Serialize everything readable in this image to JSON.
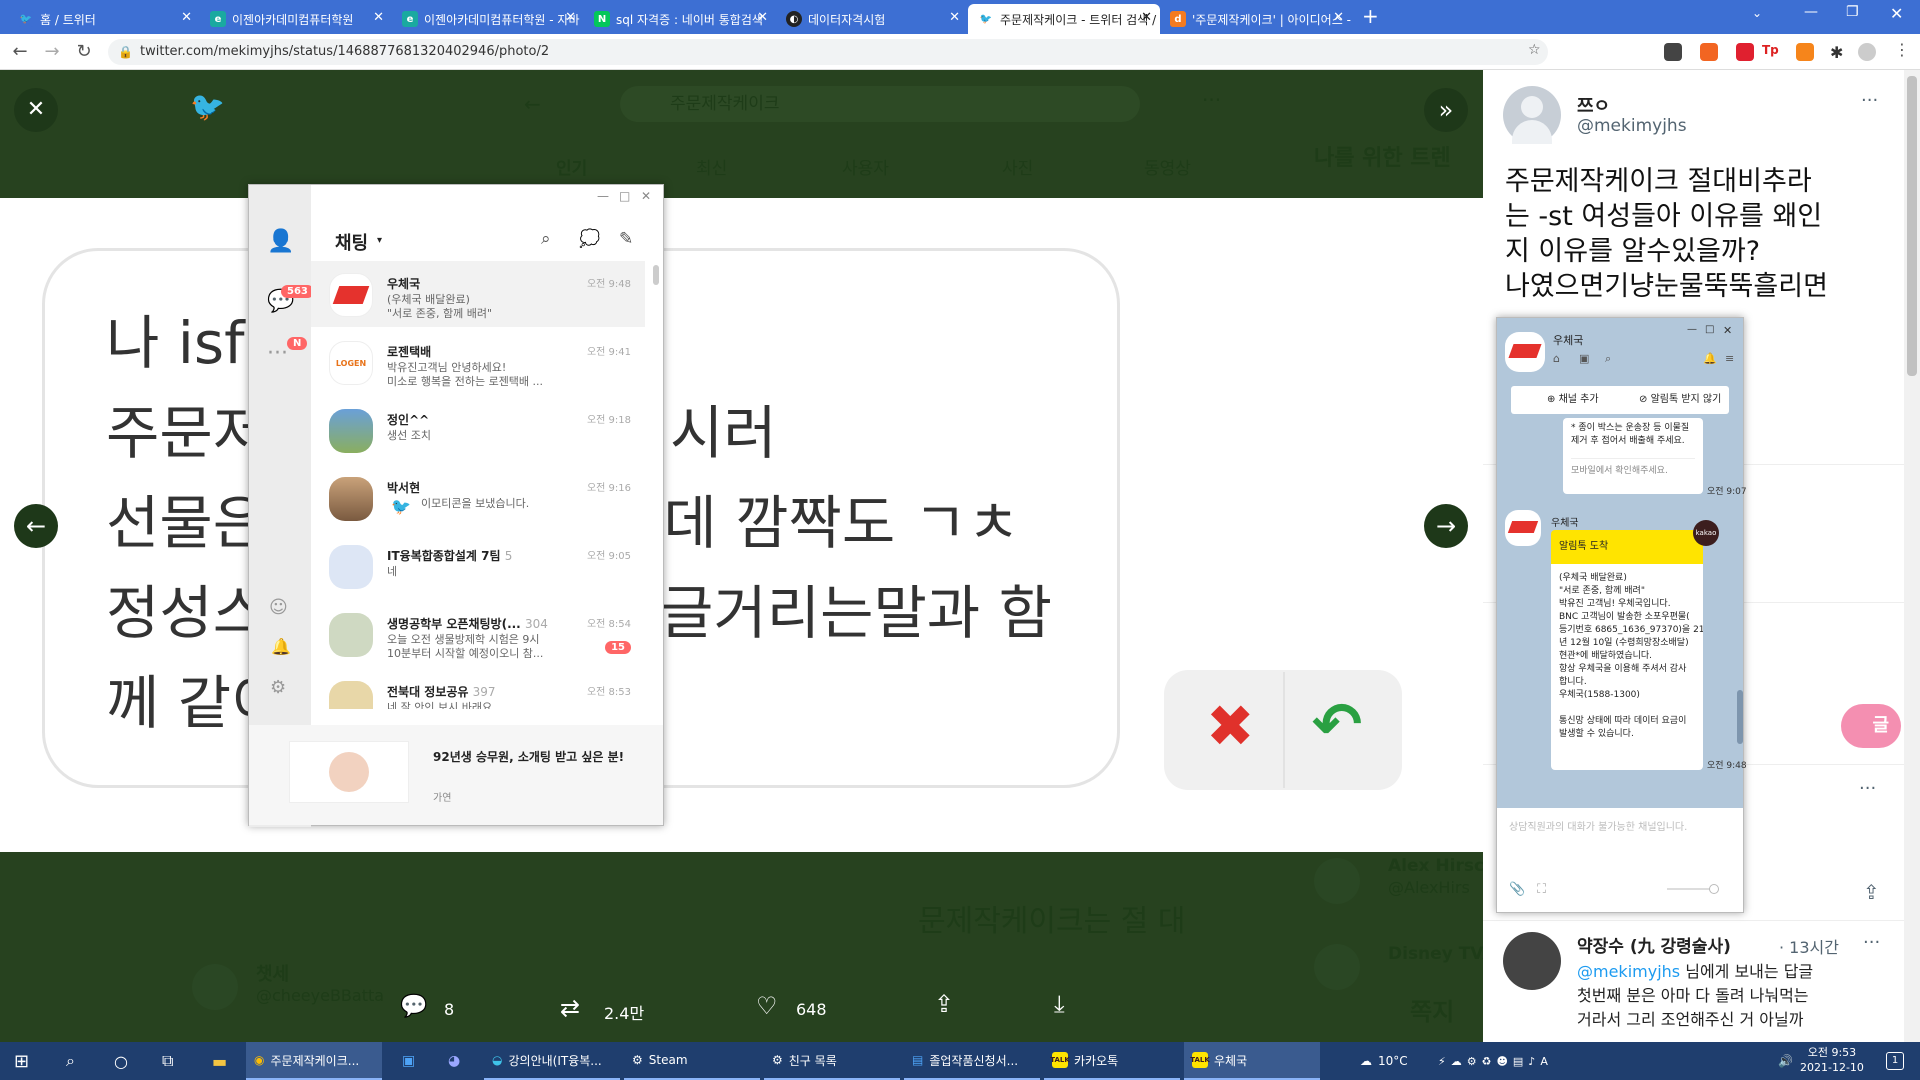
{
  "tabs": [
    {
      "title": "홈 / 트위터",
      "color": "#1d9bf0"
    },
    {
      "title": "이젠아카데미컴퓨터학원",
      "color": "#1aa9a0"
    },
    {
      "title": "이젠아카데미컴퓨터학원 - 자바",
      "color": "#1aa9a0"
    },
    {
      "title": "sql 자격증 : 네이버 통합검색",
      "color": "#03c75a"
    },
    {
      "title": "데이터자격시험",
      "color": "#222222"
    },
    {
      "title": "주문제작케이크 - 트위터 검색 / ",
      "color": "#1d9bf0"
    },
    {
      "title": "'주문제작케이크' | 아이디어스 - ",
      "color": "#f47b20"
    }
  ],
  "address": {
    "url": "twitter.com/mekimyjhs/status/1468877681320402946/photo/2"
  },
  "viewer": {
    "bg_search": "주문제작케이크",
    "bg_tabs": [
      "인기",
      "최신",
      "사용자",
      "사진",
      "동영상"
    ],
    "bg_trends": "나를 위한 트렌",
    "bg_text": "문제작케이크는 절 대",
    "bg_user1": "챗세",
    "bg_handle1": "@cheeyeBBatta",
    "bg_user2": "Alex Hirsch",
    "bg_handle2": "@AlexHirs",
    "bg_user3": "Disney TVA",
    "bg_bottom": "쪽지",
    "lines": [
      "나 isf",
      "주문저",
      "선물은",
      "정성스",
      "께 같이"
    ],
    "lines_right": [
      "시러",
      "근데 깜짝도 ㄱㅊ",
      "글거리는말과 함"
    ],
    "stats": {
      "replies": "8",
      "retweets": "2.4만",
      "likes": "648"
    }
  },
  "tweet": {
    "name": "쯔ㅇ",
    "handle": "@mekimyjhs",
    "text_lines": [
      "주문제작케이크 절대비추라",
      "는 -st 여성들아 이유를 왜인",
      "지 이유를 알수있을까?",
      "나였으면기냥눈물뚝뚝흘리면"
    ],
    "reply_name": "약장수 (九 강령술사)",
    "reply_time": "· 13시간",
    "reply_mention": "@mekimyjhs",
    "reply_text_1": "님에게 보내는 답글",
    "reply_lines": [
      "첫번째 분은 아마 다 돌려 나눠먹는",
      "거라서 그리 조언해주신 거 아닐까"
    ]
  },
  "kakao": {
    "title": "채팅",
    "badge_chats": "563",
    "badge_more": "N",
    "chats": [
      {
        "name": "우체국",
        "msg1": "(우체국 배달완료)",
        "msg2": "\"서로 존중, 함께 배려\"",
        "time": "오전 9:48"
      },
      {
        "name": "로젠택배",
        "msg1": "박유진고객님 안녕하세요!",
        "msg2": "미소로 행복을 전하는 로젠택배 ...",
        "time": "오전 9:41"
      },
      {
        "name": "정인^^",
        "msg1": "생선 조치",
        "msg2": "",
        "time": "오전 9:18"
      },
      {
        "name": "박서현",
        "msg1": "이모티콘을 보냈습니다.",
        "msg2": "",
        "time": "오전 9:16"
      },
      {
        "name": "IT융복합종합설계 7팀",
        "count": "5",
        "msg1": "네",
        "msg2": "",
        "time": "오전 9:05"
      },
      {
        "name": "생명공학부 오픈채팅방(...",
        "count": "304",
        "msg1": "오늘 오전 생물방제학 시험은 9시",
        "msg2": "10분부터 시작할 예정이오니 참...",
        "time": "오전 8:54",
        "badge": "15"
      },
      {
        "name": "전북대 정보공유",
        "count": "397",
        "msg1": "네 잘 안인 보시 바래요",
        "msg2": "",
        "time": "오전 8:53"
      }
    ],
    "ad_title": "92년생 승무원, 소개팅 받고 싶은 분!",
    "ad_sub": "가연"
  },
  "post": {
    "title": "우체국",
    "add_channel": "채널 추가",
    "block": "알림톡 받지 않기",
    "prev_msg1": "* 종이 박스는 운송장 등 이물질 제거 후 접어서 배출해 주세요.",
    "prev_link": "모바일에서 확인해주세요.",
    "prev_time": "오전 9:07",
    "sender": "우체국",
    "header": "알림톡 도착",
    "kakao_label": "kakao",
    "body": [
      "(우체국 배달완료)",
      "\"서로 존중, 함께 배려\"",
      "박유진 고객님! 우체국입니다.",
      "BNC 고객님이 발송한 소포우편물(",
      "등기번호 6865_1636_97370)을 21",
      "년 12월 10일 (수령희망장소배달)",
      "현관*에 배달하였습니다.",
      "항상 우체국을 이용해 주셔서 감사",
      "합니다.",
      "우체국(1588-1300)",
      "",
      "통신망 상태에 따라 데이터 요금이",
      "발생할 수 있습니다."
    ],
    "time": "오전 9:48",
    "input_placeholder": "상담직원과의 대화가 불가능한 채널입니다."
  },
  "taskbar": {
    "items": [
      "주문제작케이크...",
      "강의안내(IT융복...",
      "Steam",
      "친구 목록",
      "졸업작품신청서...",
      "카카오톡",
      "우체국"
    ],
    "weather": "10°C",
    "time": "오전 9:53",
    "date": "2021-12-10",
    "notif": "1"
  }
}
